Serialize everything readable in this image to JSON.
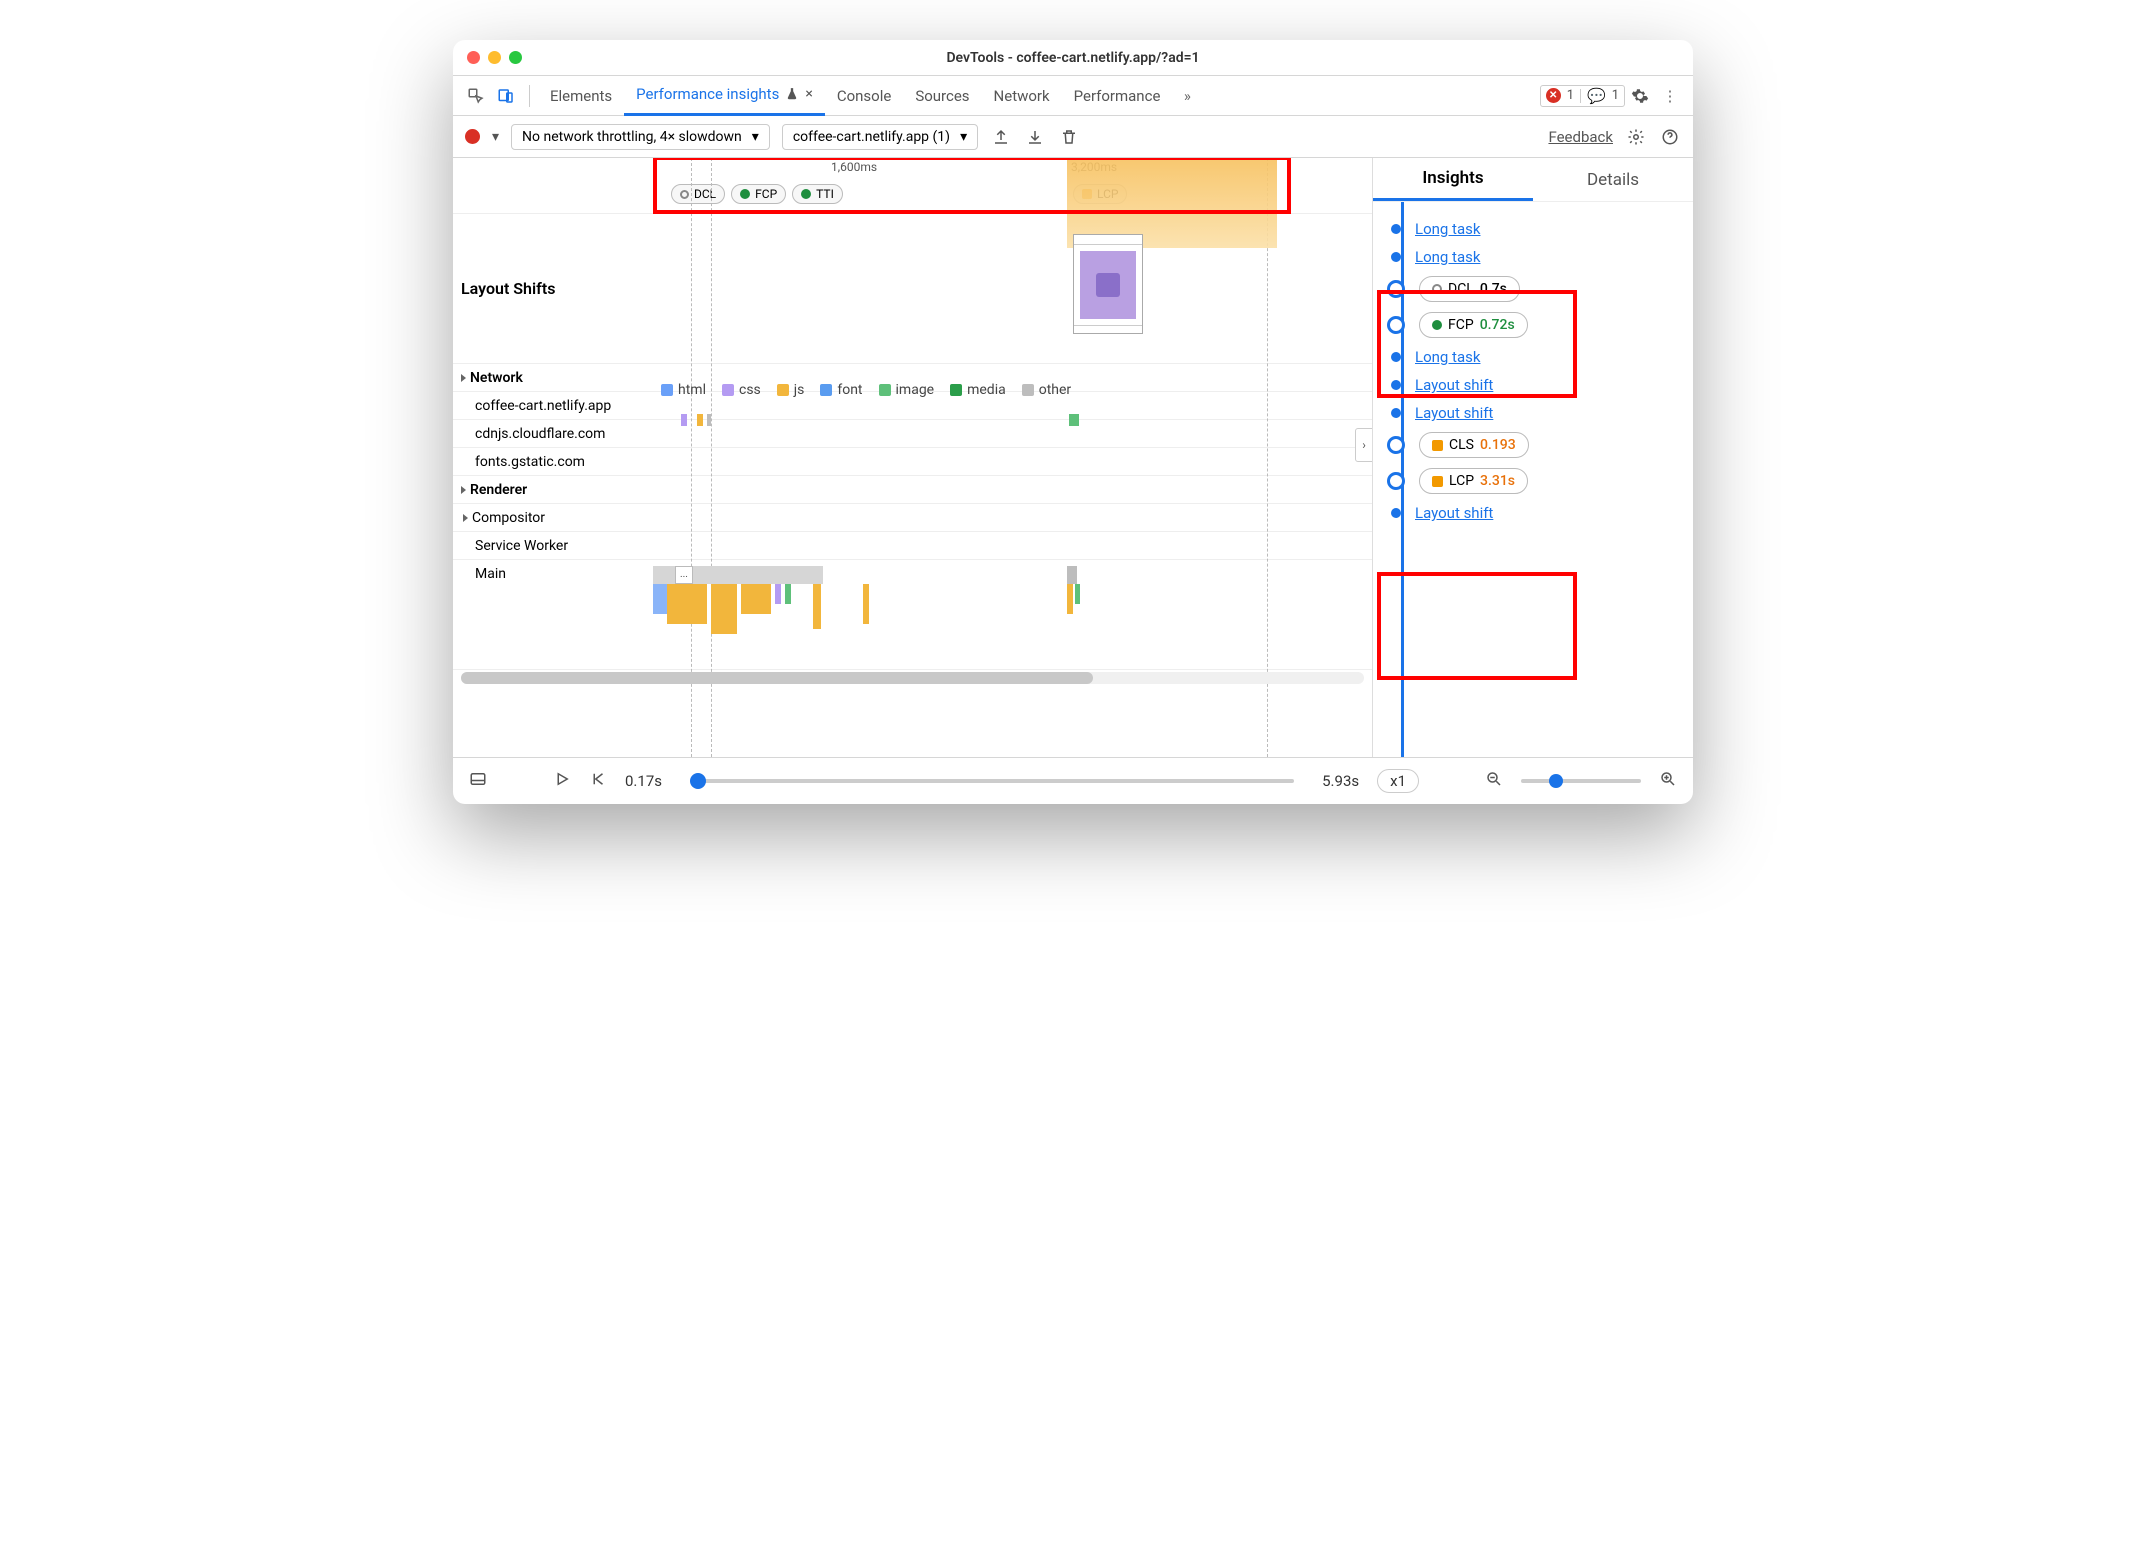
{
  "window": {
    "title": "DevTools - coffee-cart.netlify.app/?ad=1"
  },
  "tabs": {
    "elements": "Elements",
    "perf_insights": "Performance insights",
    "console": "Console",
    "sources": "Sources",
    "network": "Network",
    "performance": "Performance",
    "more_icon": "»",
    "error_count": "1",
    "message_count": "1"
  },
  "toolbar": {
    "throttling": "No network throttling, 4× slowdown",
    "profile": "coffee-cart.netlify.app (1)",
    "feedback": "Feedback"
  },
  "ruler": {
    "t1": "1,600ms",
    "t2": "3,200ms",
    "pills": {
      "dcl": "DCL",
      "fcp": "FCP",
      "tti": "TTI",
      "lcp": "LCP"
    }
  },
  "rows": {
    "layout_shifts": "Layout Shifts",
    "network": "Network",
    "renderer": "Renderer",
    "compositor": "Compositor",
    "service_worker": "Service Worker",
    "main": "Main",
    "hosts": [
      "coffee-cart.netlify.app",
      "cdnjs.cloudflare.com",
      "fonts.gstatic.com"
    ]
  },
  "legend": {
    "html": "html",
    "css": "css",
    "js": "js",
    "font": "font",
    "image": "image",
    "media": "media",
    "other": "other"
  },
  "legend_colors": {
    "html": "#6aa0f8",
    "css": "#b49bf2",
    "js": "#f2b63c",
    "font": "#5a9cf0",
    "image": "#5ec07a",
    "media": "#2b9e4a",
    "other": "#bdbdbd"
  },
  "insights_panel": {
    "tab_insights": "Insights",
    "tab_details": "Details",
    "items": [
      {
        "type": "link",
        "text": "Long task"
      },
      {
        "type": "link",
        "text": "Long task"
      },
      {
        "type": "pill",
        "icon": "hollow",
        "label": "DCL",
        "value": "0.7s",
        "value_class": ""
      },
      {
        "type": "pill",
        "icon": "green",
        "label": "FCP",
        "value": "0.72s",
        "value_class": "green"
      },
      {
        "type": "link",
        "text": "Long task"
      },
      {
        "type": "link",
        "text": "Layout shift"
      },
      {
        "type": "link",
        "text": "Layout shift"
      },
      {
        "type": "pill",
        "icon": "sq",
        "label": "CLS",
        "value": "0.193",
        "value_class": "orange"
      },
      {
        "type": "pill",
        "icon": "sq",
        "label": "LCP",
        "value": "3.31s",
        "value_class": "orange"
      },
      {
        "type": "link",
        "text": "Layout shift"
      }
    ]
  },
  "footer": {
    "start": "0.17s",
    "end": "5.93s",
    "speed": "x1"
  }
}
